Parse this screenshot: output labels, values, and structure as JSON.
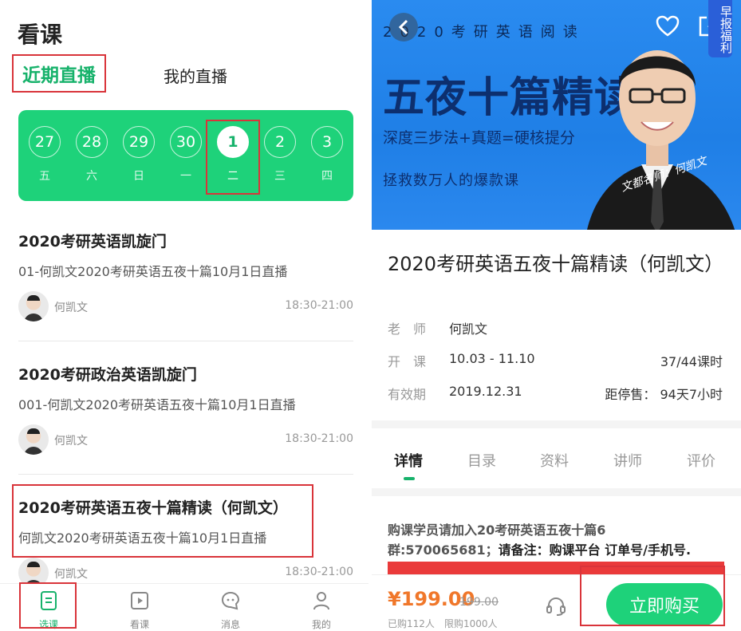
{
  "left": {
    "status_fragment": "",
    "page_title": "看课",
    "tabs": {
      "recent": "近期直播",
      "mine": "我的直播"
    },
    "days": [
      {
        "num": "27",
        "wd": "五"
      },
      {
        "num": "28",
        "wd": "六"
      },
      {
        "num": "29",
        "wd": "日"
      },
      {
        "num": "30",
        "wd": "一"
      },
      {
        "num": "1",
        "wd": "二"
      },
      {
        "num": "2",
        "wd": "三"
      },
      {
        "num": "3",
        "wd": "四"
      }
    ],
    "courses": [
      {
        "title": "2020考研英语凯旋门",
        "subtitle": "01-何凯文2020考研英语五夜十篇10月1日直播",
        "teacher": "何凯文",
        "time": "18:30-21:00"
      },
      {
        "title": "2020考研政治英语凯旋门",
        "subtitle": "001-何凯文2020考研英语五夜十篇10月1日直播",
        "teacher": "何凯文",
        "time": "18:30-21:00"
      },
      {
        "title": "2020考研英语五夜十篇精读（何凯文）",
        "subtitle": "何凯文2020考研英语五夜十篇10月1日直播",
        "teacher": "何凯文",
        "time": "18:30-21:00"
      }
    ],
    "nav": [
      {
        "label": "选课",
        "icon": "select-course-icon"
      },
      {
        "label": "看课",
        "icon": "play-icon"
      },
      {
        "label": "消息",
        "icon": "message-icon"
      },
      {
        "label": "我的",
        "icon": "profile-icon"
      }
    ]
  },
  "right": {
    "banner": {
      "subtitle": "2020考研英语阅读",
      "headline": "五夜十篇精读",
      "line3": "深度三步法+真题=硬核提分",
      "line4": "拯救数万人的爆款课",
      "badge": "早报福利",
      "signature": "文都名师：何凯文"
    },
    "course_title": "2020考研英语五夜十篇精读（何凯文）",
    "info": {
      "teacher_label": "老　师",
      "teacher": "何凯文",
      "open_label": "开　课",
      "open": "10.03 - 11.10",
      "hours": "37/44课时",
      "valid_label": "有效期",
      "valid": "2019.12.31",
      "stop_label": "距停售：",
      "stop": "94天7小时"
    },
    "detail_tabs": [
      "详情",
      "目录",
      "资料",
      "讲师",
      "评价"
    ],
    "notice_a": "购课学员请加入20考研英语五夜十篇6",
    "notice_b": "群:570065681；",
    "notice_c": "请备注：购课平台 订单号/手机号.",
    "price": "¥199.00",
    "old_price": "199.00",
    "sold": "已购112人",
    "limit": "限购1000人",
    "buy_label": "立即购买"
  },
  "colors": {
    "accent": "#1ed27a",
    "highlight": "#d9343a",
    "price": "#f0772a",
    "banner": "#2a8bf0"
  }
}
